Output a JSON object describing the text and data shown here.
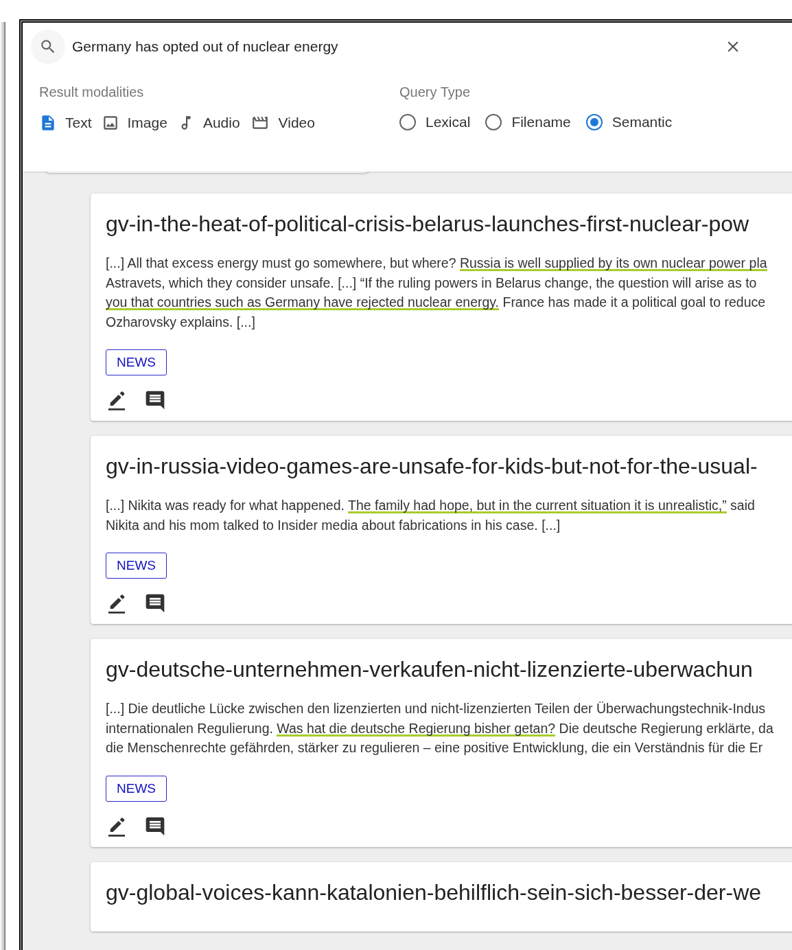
{
  "search": {
    "value": "Germany has opted out of nuclear energy"
  },
  "modalities": {
    "label": "Result modalities",
    "items": [
      {
        "kind": "text",
        "label": "Text",
        "selected": true
      },
      {
        "kind": "image",
        "label": "Image",
        "selected": false
      },
      {
        "kind": "audio",
        "label": "Audio",
        "selected": false
      },
      {
        "kind": "video",
        "label": "Video",
        "selected": false
      }
    ]
  },
  "query_type": {
    "label": "Query Type",
    "options": [
      {
        "label": "Lexical",
        "selected": false
      },
      {
        "label": "Filename",
        "selected": false
      },
      {
        "label": "Semantic",
        "selected": true
      }
    ]
  },
  "results": [
    {
      "title": "gv-in-the-heat-of-political-crisis-belarus-launches-first-nuclear-pow",
      "snippet": [
        [
          {
            "text": "[...] All that excess energy must go somewhere, but where? ",
            "highlighted": false
          },
          {
            "text": "Russia is well supplied by its own nuclear power pla",
            "highlighted": true
          }
        ],
        [
          {
            "text": "Astravets, which they consider unsafe. [...] “If the ruling powers in Belarus change, the question will arise as to",
            "highlighted": false
          }
        ],
        [
          {
            "text": "you that countries such as Germany have rejected nuclear energy.",
            "highlighted": true
          },
          {
            "text": " France has made it a political goal to reduce",
            "highlighted": false
          }
        ],
        [
          {
            "text": "Ozharovsky explains. [...]",
            "highlighted": false
          }
        ]
      ],
      "tag": "NEWS"
    },
    {
      "title": "gv-in-russia-video-games-are-unsafe-for-kids-but-not-for-the-usual-",
      "snippet": [
        [
          {
            "text": "[...] Nikita was ready for what happened. ",
            "highlighted": false
          },
          {
            "text": "The family had hope, but in the current situation it is unrealistic,”",
            "highlighted": true
          },
          {
            "text": " said",
            "highlighted": false
          }
        ],
        [
          {
            "text": "Nikita and his mom talked to Insider media about fabrications in his case. [...]",
            "highlighted": false
          }
        ]
      ],
      "tag": "NEWS"
    },
    {
      "title": "gv-deutsche-unternehmen-verkaufen-nicht-lizenzierte-uberwachun",
      "snippet": [
        [
          {
            "text": "[...] Die deutliche Lücke zwischen den lizenzierten und nicht-lizenzierten Teilen der Überwachungstechnik-Indus",
            "highlighted": false
          }
        ],
        [
          {
            "text": "internationalen Regulierung. ",
            "highlighted": false
          },
          {
            "text": "Was hat die deutsche Regierung bisher getan?",
            "highlighted": true
          },
          {
            "text": " Die deutsche Regierung erklärte, da",
            "highlighted": false
          }
        ],
        [
          {
            "text": "die Menschenrechte gefährden, stärker zu regulieren – eine positive Entwicklung, die ein Verständnis für die Er",
            "highlighted": false
          }
        ]
      ],
      "tag": "NEWS"
    },
    {
      "title": "gv-global-voices-kann-katalonien-behilflich-sein-sich-besser-der-we"
    }
  ]
}
